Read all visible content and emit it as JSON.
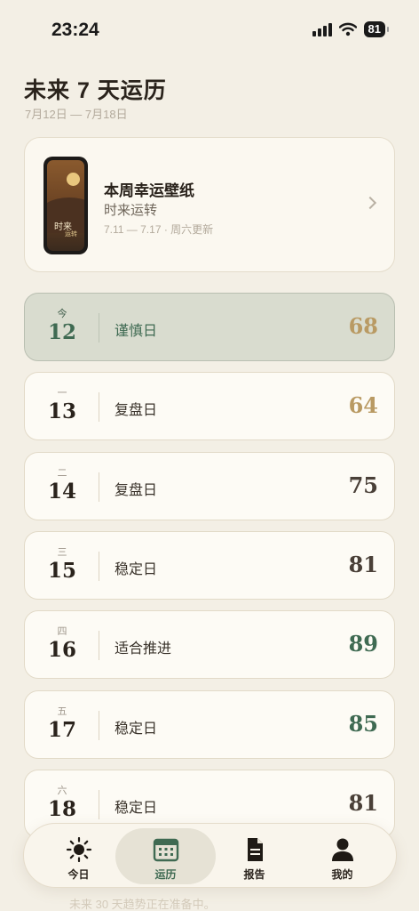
{
  "status": {
    "time": "23:24",
    "battery": "81"
  },
  "header": {
    "title": "未来 7 天运历",
    "subtitle": "7月12日 — 7月18日"
  },
  "wallpaper": {
    "title": "本周幸运壁纸",
    "name": "时来运转",
    "meta": "7.11 — 7.17 · 周六更新",
    "thumb_text1": "时来",
    "thumb_text2": "运转"
  },
  "days": [
    {
      "weekday": "今",
      "day": "12",
      "label": "谨慎日",
      "score": "68",
      "score_color": "#b99a63",
      "today": true
    },
    {
      "weekday": "一",
      "day": "13",
      "label": "复盘日",
      "score": "64",
      "score_color": "#b99a63",
      "today": false
    },
    {
      "weekday": "二",
      "day": "14",
      "label": "复盘日",
      "score": "75",
      "score_color": "#4a4038",
      "today": false
    },
    {
      "weekday": "三",
      "day": "15",
      "label": "稳定日",
      "score": "81",
      "score_color": "#4a4038",
      "today": false
    },
    {
      "weekday": "四",
      "day": "16",
      "label": "适合推进",
      "score": "89",
      "score_color": "#3f6a52",
      "today": false
    },
    {
      "weekday": "五",
      "day": "17",
      "label": "稳定日",
      "score": "85",
      "score_color": "#3f6a52",
      "today": false
    },
    {
      "weekday": "六",
      "day": "18",
      "label": "稳定日",
      "score": "81",
      "score_color": "#4a4038",
      "today": false
    }
  ],
  "footer_text": "未来 30 天趋势正在准备中。",
  "tabs": [
    {
      "label": "今日",
      "icon": "sun-icon"
    },
    {
      "label": "运历",
      "icon": "calendar-icon",
      "active": true
    },
    {
      "label": "报告",
      "icon": "document-icon"
    },
    {
      "label": "我的",
      "icon": "person-icon"
    }
  ]
}
